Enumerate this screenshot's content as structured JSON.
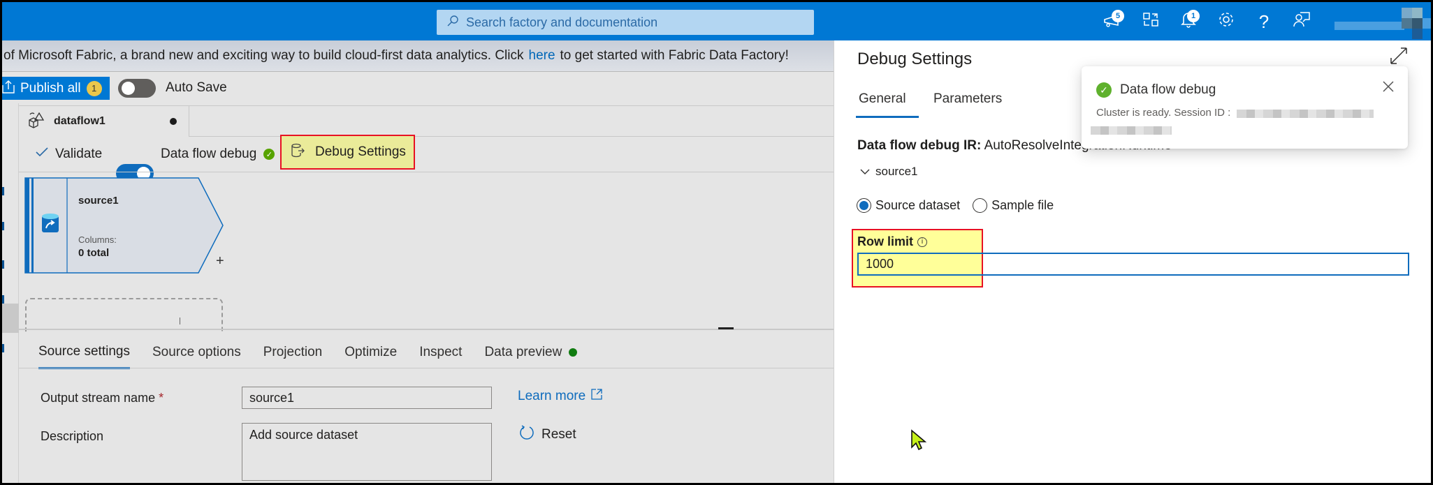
{
  "topbar": {
    "search_placeholder": "Search factory and documentation",
    "icons": [
      {
        "name": "announcements-icon",
        "badge": "5"
      },
      {
        "name": "switch-directory-icon",
        "badge": null
      },
      {
        "name": "notifications-icon",
        "badge": "1"
      },
      {
        "name": "settings-icon",
        "badge": null
      },
      {
        "name": "help-icon",
        "badge": null
      },
      {
        "name": "feedback-icon",
        "badge": null
      }
    ],
    "accent": "#0078d4"
  },
  "banner": {
    "text_before": "of Microsoft Fabric, a brand new and exciting way to build cloud-first data analytics. Click",
    "link": "here",
    "text_after": "to get started with Fabric Data Factory!"
  },
  "actions": {
    "publish_label": "Publish all",
    "publish_count": "1",
    "autosave_label": "Auto Save",
    "autosave_on": false
  },
  "doc_tab": {
    "name": "dataflow1",
    "unsaved": true
  },
  "toolbar": {
    "validate_label": "Validate",
    "debug_label": "Data flow debug",
    "debug_on": true,
    "debug_settings_label": "Debug Settings"
  },
  "canvas": {
    "node": {
      "title": "source1",
      "columns_label": "Columns:",
      "columns_value": "0 total",
      "add_symbol": "+"
    }
  },
  "bottom_panel": {
    "tabs": [
      {
        "label": "Source settings",
        "active": true
      },
      {
        "label": "Source options",
        "active": false
      },
      {
        "label": "Projection",
        "active": false
      },
      {
        "label": "Optimize",
        "active": false
      },
      {
        "label": "Inspect",
        "active": false
      },
      {
        "label": "Data preview",
        "active": false,
        "status_dot": true
      }
    ],
    "fields": {
      "output_stream_label": "Output stream name",
      "required_mark": "*",
      "output_stream_value": "source1",
      "description_label": "Description",
      "description_value": "Add source dataset",
      "learn_more": "Learn more",
      "reset": "Reset"
    }
  },
  "debug_pane": {
    "title": "Debug Settings",
    "tabs": [
      {
        "label": "General",
        "active": true
      },
      {
        "label": "Parameters",
        "active": false
      }
    ],
    "ir_label": "Data flow debug IR:",
    "ir_value": "AutoResolveIntegrationRuntime",
    "source_section": "source1",
    "radio_options": [
      {
        "label": "Source dataset",
        "selected": true
      },
      {
        "label": "Sample file",
        "selected": false
      }
    ],
    "row_limit_label": "Row limit",
    "row_limit_value": "1000"
  },
  "toast": {
    "title": "Data flow debug",
    "message": "Cluster is ready. Session ID :",
    "status": "success"
  }
}
